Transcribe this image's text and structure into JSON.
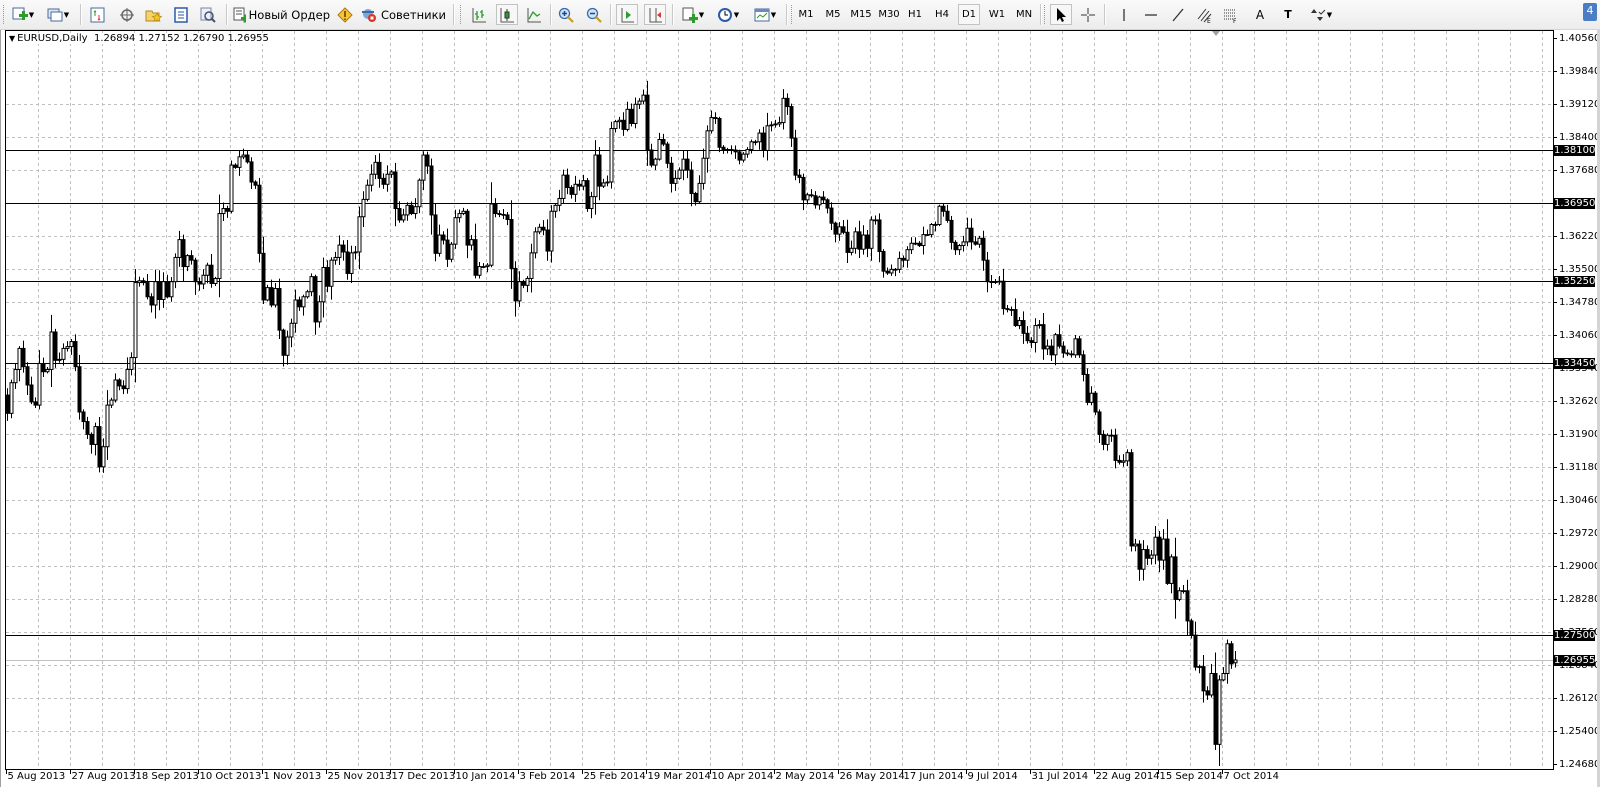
{
  "toolbar": {
    "new_order_label": "Новый Ордер",
    "experts_label": "Советники",
    "timeframes": [
      "M1",
      "M5",
      "M15",
      "M30",
      "H1",
      "H4",
      "D1",
      "W1",
      "MN"
    ],
    "active_timeframe": "D1",
    "notification_count": "4",
    "text_tool_label": "A",
    "text_label_tool_label": "T"
  },
  "chart": {
    "symbol_header": "EURUSD,Daily",
    "ohlc_header": "1.26894 1.27152 1.26790 1.26955",
    "bid_label": "1.26955",
    "levels": [
      {
        "value": 1.381,
        "label": "1.38100"
      },
      {
        "value": 1.3695,
        "label": "1.36950"
      },
      {
        "value": 1.3525,
        "label": "1.35250"
      },
      {
        "value": 1.3345,
        "label": "1.33450"
      },
      {
        "value": 1.275,
        "label": "1.27500"
      }
    ],
    "colors": {
      "background": "#ffffff",
      "candle": "#000000",
      "grid": "#c0c0c0",
      "bid_line": "#c0c0c0",
      "level_line": "#000000"
    }
  },
  "chart_data": {
    "type": "candlestick",
    "symbol": "EURUSD",
    "timeframe": "Daily",
    "yrange": [
      1.2468,
      1.4056
    ],
    "y_ticks": [
      "1.40560",
      "1.39840",
      "1.39120",
      "1.38400",
      "1.37680",
      "",
      "1.36220",
      "1.35500",
      "1.34780",
      "1.34060",
      "1.33340",
      "1.32620",
      "1.31900",
      "1.31180",
      "1.30460",
      "1.29720",
      "1.29000",
      "1.28280",
      "1.27560",
      "1.26840",
      "1.26120",
      "1.25400",
      "1.24680"
    ],
    "x_ticks": [
      "5 Aug 2013",
      "27 Aug 2013",
      "18 Sep 2013",
      "10 Oct 2013",
      "1 Nov 2013",
      "25 Nov 2013",
      "17 Dec 2013",
      "10 Jan 2014",
      "3 Feb 2014",
      "25 Feb 2014",
      "19 Mar 2014",
      "10 Apr 2014",
      "2 May 2014",
      "26 May 2014",
      "17 Jun 2014",
      "9 Jul 2014",
      "31 Jul 2014",
      "22 Aug 2014",
      "15 Sep 2014",
      "7 Oct 2014"
    ],
    "bars_per_x_tick": 16,
    "first_open": 1.3275,
    "last_bar": {
      "open": 1.26894,
      "high": 1.27152,
      "low": 1.2679,
      "close": 1.26955
    },
    "closes": [
      1.3235,
      1.3302,
      1.3331,
      1.3377,
      1.3337,
      1.3297,
      1.326,
      1.3253,
      1.3344,
      1.3326,
      1.3331,
      1.3413,
      1.3351,
      1.3353,
      1.3377,
      1.3381,
      1.3392,
      1.3337,
      1.3238,
      1.3217,
      1.3189,
      1.3167,
      1.3206,
      1.3118,
      1.3162,
      1.3253,
      1.3264,
      1.3308,
      1.3295,
      1.3289,
      1.3331,
      1.3357,
      1.3521,
      1.3525,
      1.3521,
      1.349,
      1.3472,
      1.3523,
      1.3484,
      1.3523,
      1.349,
      1.3523,
      1.3576,
      1.3615,
      1.3556,
      1.358,
      1.357,
      1.3523,
      1.3518,
      1.3537,
      1.3559,
      1.3519,
      1.353,
      1.3672,
      1.3683,
      1.3677,
      1.3778,
      1.3773,
      1.3796,
      1.38,
      1.3785,
      1.3741,
      1.3734,
      1.3585,
      1.3483,
      1.351,
      1.3472,
      1.3508,
      1.3417,
      1.3362,
      1.3402,
      1.3432,
      1.3483,
      1.3468,
      1.349,
      1.3501,
      1.3534,
      1.3435,
      1.3479,
      1.3554,
      1.3513,
      1.357,
      1.3576,
      1.3603,
      1.3588,
      1.3541,
      1.3586,
      1.3588,
      1.3665,
      1.3703,
      1.3734,
      1.3758,
      1.3784,
      1.3749,
      1.3736,
      1.3758,
      1.3763,
      1.3683,
      1.3658,
      1.3669,
      1.369,
      1.3672,
      1.3687,
      1.3745,
      1.38,
      1.3776,
      1.3669,
      1.3585,
      1.3625,
      1.3614,
      1.3572,
      1.3605,
      1.3663,
      1.3672,
      1.3677,
      1.3603,
      1.3615,
      1.3537,
      1.3556,
      1.3556,
      1.3559,
      1.3693,
      1.3672,
      1.367,
      1.3669,
      1.3659,
      1.3552,
      1.3481,
      1.3523,
      1.3515,
      1.353,
      1.3586,
      1.3632,
      1.3642,
      1.3636,
      1.359,
      1.3677,
      1.369,
      1.3705,
      1.3756,
      1.3729,
      1.3714,
      1.3736,
      1.3732,
      1.3744,
      1.3683,
      1.3709,
      1.38,
      1.3732,
      1.3739,
      1.3741,
      1.3858,
      1.3873,
      1.3876,
      1.3856,
      1.39,
      1.3869,
      1.3911,
      1.3918,
      1.3931,
      1.3811,
      1.3778,
      1.3791,
      1.3834,
      1.3824,
      1.3782,
      1.3738,
      1.3749,
      1.3767,
      1.3791,
      1.3767,
      1.3716,
      1.3698,
      1.3738,
      1.3793,
      1.3853,
      1.3882,
      1.388,
      1.3817,
      1.381,
      1.3812,
      1.3811,
      1.3807,
      1.3789,
      1.3802,
      1.3812,
      1.3829,
      1.3829,
      1.3848,
      1.381,
      1.3864,
      1.3866,
      1.3868,
      1.3871,
      1.3924,
      1.3906,
      1.3837,
      1.3756,
      1.3751,
      1.3702,
      1.3713,
      1.3711,
      1.3691,
      1.3708,
      1.3702,
      1.3684,
      1.3651,
      1.3627,
      1.3643,
      1.3631,
      1.3587,
      1.3596,
      1.3632,
      1.3594,
      1.3625,
      1.3596,
      1.3658,
      1.3658,
      1.3589,
      1.3546,
      1.3542,
      1.355,
      1.355,
      1.3574,
      1.357,
      1.3593,
      1.3607,
      1.3607,
      1.3602,
      1.3626,
      1.3626,
      1.3648,
      1.3648,
      1.3688,
      1.3677,
      1.3657,
      1.3609,
      1.3593,
      1.3602,
      1.361,
      1.364,
      1.361,
      1.3605,
      1.3618,
      1.357,
      1.3523,
      1.3523,
      1.3523,
      1.3524,
      1.3464,
      1.3462,
      1.3462,
      1.3427,
      1.3438,
      1.341,
      1.3394,
      1.339,
      1.3427,
      1.3429,
      1.3376,
      1.3382,
      1.3363,
      1.3407,
      1.3382,
      1.3367,
      1.3365,
      1.3363,
      1.3398,
      1.3363,
      1.332,
      1.3259,
      1.3279,
      1.3238,
      1.3189,
      1.3167,
      1.3187,
      1.3187,
      1.3132,
      1.3128,
      1.3131,
      1.3149,
      1.2945,
      1.2949,
      1.2894,
      1.2937,
      1.2918,
      1.2925,
      1.2964,
      1.2914,
      1.296,
      1.2863,
      1.2921,
      1.2828,
      1.2847,
      1.2847,
      1.2781,
      1.275,
      1.268,
      1.2681,
      1.2628,
      1.2619,
      1.2666,
      1.2511,
      1.2652,
      1.2666,
      1.2731,
      1.2687,
      1.26955
    ]
  }
}
